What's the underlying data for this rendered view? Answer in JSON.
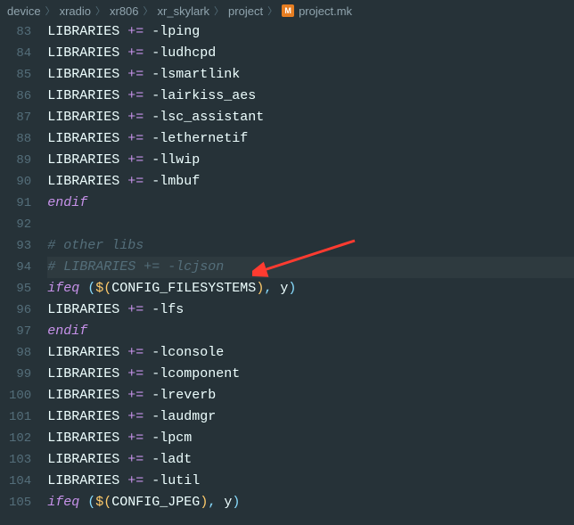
{
  "breadcrumb": {
    "items": [
      "device",
      "xradio",
      "xr806",
      "xr_skylark",
      "project",
      "project.mk"
    ],
    "file_icon_letter": "M"
  },
  "editor": {
    "first_line_number": 83,
    "highlighted_line": 94,
    "lines": [
      {
        "type": "assign",
        "lhs": "LIBRARIES",
        "op": "+=",
        "rhs": "-lping"
      },
      {
        "type": "assign",
        "lhs": "LIBRARIES",
        "op": "+=",
        "rhs": "-ludhcpd"
      },
      {
        "type": "assign",
        "lhs": "LIBRARIES",
        "op": "+=",
        "rhs": "-lsmartlink"
      },
      {
        "type": "assign",
        "lhs": "LIBRARIES",
        "op": "+=",
        "rhs": "-lairkiss_aes"
      },
      {
        "type": "assign",
        "lhs": "LIBRARIES",
        "op": "+=",
        "rhs": "-lsc_assistant"
      },
      {
        "type": "assign",
        "lhs": "LIBRARIES",
        "op": "+=",
        "rhs": "-lethernetif"
      },
      {
        "type": "assign",
        "lhs": "LIBRARIES",
        "op": "+=",
        "rhs": "-llwip"
      },
      {
        "type": "assign",
        "lhs": "LIBRARIES",
        "op": "+=",
        "rhs": "-lmbuf"
      },
      {
        "type": "keyword",
        "text": "endif"
      },
      {
        "type": "blank"
      },
      {
        "type": "comment",
        "text": "# other libs"
      },
      {
        "type": "comment",
        "text": "# LIBRARIES += -lcjson"
      },
      {
        "type": "ifeq",
        "var": "CONFIG_FILESYSTEMS",
        "val": "y"
      },
      {
        "type": "assign",
        "lhs": "LIBRARIES",
        "op": "+=",
        "rhs": "-lfs"
      },
      {
        "type": "keyword",
        "text": "endif"
      },
      {
        "type": "assign",
        "lhs": "LIBRARIES",
        "op": "+=",
        "rhs": "-lconsole"
      },
      {
        "type": "assign",
        "lhs": "LIBRARIES",
        "op": "+=",
        "rhs": "-lcomponent"
      },
      {
        "type": "assign",
        "lhs": "LIBRARIES",
        "op": "+=",
        "rhs": "-lreverb"
      },
      {
        "type": "assign",
        "lhs": "LIBRARIES",
        "op": "+=",
        "rhs": "-laudmgr"
      },
      {
        "type": "assign",
        "lhs": "LIBRARIES",
        "op": "+=",
        "rhs": "-lpcm"
      },
      {
        "type": "assign",
        "lhs": "LIBRARIES",
        "op": "+=",
        "rhs": "-ladt"
      },
      {
        "type": "assign",
        "lhs": "LIBRARIES",
        "op": "+=",
        "rhs": "-lutil"
      },
      {
        "type": "ifeq",
        "var": "CONFIG_JPEG",
        "val": "y"
      }
    ]
  },
  "annotation": {
    "arrow_color": "#FF3B30"
  }
}
